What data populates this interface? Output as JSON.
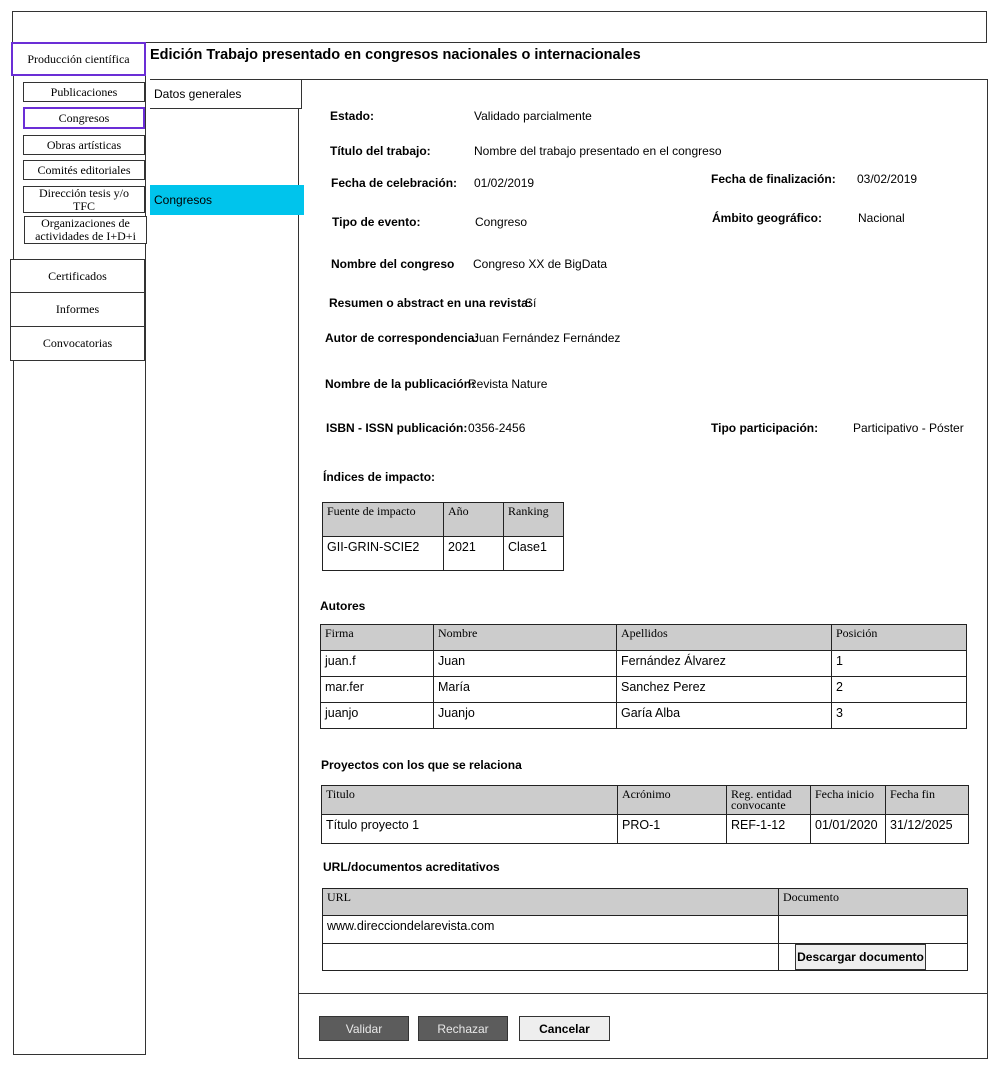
{
  "page": {
    "title": "Edición Trabajo presentado en congresos nacionales o internacionales"
  },
  "sidebar": {
    "items": [
      {
        "label": "Producción científica"
      },
      {
        "label": "Publicaciones"
      },
      {
        "label": "Congresos"
      },
      {
        "label": "Obras artísticas"
      },
      {
        "label": "Comités editoriales"
      },
      {
        "label": "Dirección tesis y/o TFC"
      },
      {
        "label": "Organizaciones de actividades de I+D+i"
      },
      {
        "label": "Certificados"
      },
      {
        "label": "Informes"
      },
      {
        "label": "Convocatorias"
      }
    ],
    "active_color": "#6b2ed6"
  },
  "subnav": {
    "general": "Datos generales",
    "active": "Congresos",
    "active_color": "#00c4ec"
  },
  "form": {
    "estado": {
      "label": "Estado:",
      "value": "Validado parcialmente"
    },
    "titulo": {
      "label": "Título del trabajo:",
      "value": "Nombre del trabajo presentado en el congreso"
    },
    "fecha_celebracion": {
      "label": "Fecha de celebración:",
      "value": "01/02/2019"
    },
    "fecha_finalizacion": {
      "label": "Fecha de finalización:",
      "value": "03/02/2019"
    },
    "tipo_evento": {
      "label": "Tipo de evento:",
      "value": "Congreso"
    },
    "ambito": {
      "label": "Ámbito geográfico:",
      "value": "Nacional"
    },
    "nombre_congreso": {
      "label": "Nombre del congreso",
      "value": "Congreso XX de BigData"
    },
    "resumen": {
      "label": "Resumen o abstract en una revista:",
      "value": "Sí"
    },
    "autor_correspondencia": {
      "label": "Autor de correspondencia:",
      "value": "Juan Fernández Fernández"
    },
    "nombre_publicacion": {
      "label": "Nombre de la publicación:",
      "value": "Revista Nature"
    },
    "isbn": {
      "label": "ISBN - ISSN publicación:",
      "value": "0356-2456"
    },
    "tipo_participacion": {
      "label": "Tipo participación:",
      "value": "Participativo - Póster"
    }
  },
  "indices": {
    "title": "Índices de impacto:",
    "headers": [
      "Fuente de impacto",
      "Año",
      "Ranking"
    ],
    "rows": [
      [
        "GII-GRIN-SCIE2",
        "2021",
        "Clase1"
      ]
    ]
  },
  "autores": {
    "title": "Autores",
    "headers": [
      "Firma",
      "Nombre",
      "Apellidos",
      "Posición"
    ],
    "rows": [
      [
        "juan.f",
        "Juan",
        "Fernández Álvarez",
        "1"
      ],
      [
        "mar.fer",
        "María",
        "Sanchez Perez",
        "2"
      ],
      [
        "juanjo",
        "Juanjo",
        "Garía Alba",
        "3"
      ]
    ]
  },
  "proyectos": {
    "title": "Proyectos con los que se relaciona",
    "headers": [
      "Titulo",
      "Acrónimo",
      "Reg. entidad convocante",
      "Fecha inicio",
      "Fecha fin"
    ],
    "rows": [
      [
        "Título proyecto 1",
        "PRO-1",
        "REF-1-12",
        "01/01/2020",
        "31/12/2025"
      ]
    ]
  },
  "urls": {
    "title": "URL/documentos acreditativos",
    "headers": [
      "URL",
      "Documento"
    ],
    "rows": [
      [
        "www.direcciondelarevista.com",
        ""
      ]
    ],
    "download_label": "Descargar documento"
  },
  "actions": {
    "validar": "Validar",
    "rechazar": "Rechazar",
    "cancelar": "Cancelar"
  }
}
